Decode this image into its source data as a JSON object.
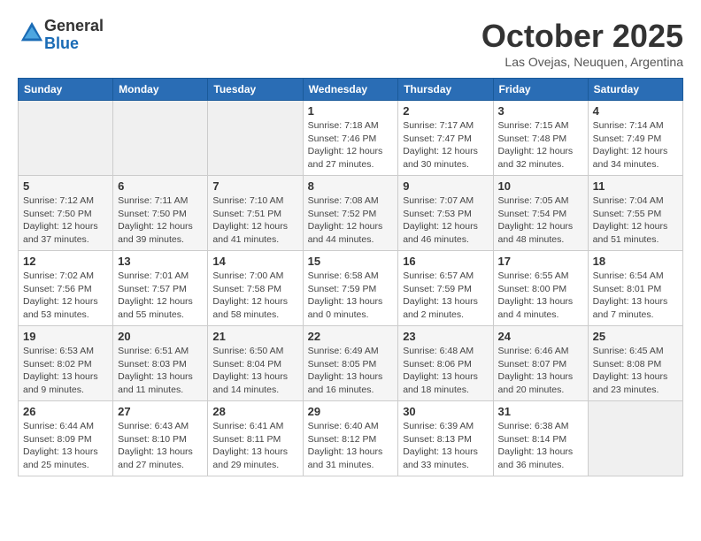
{
  "header": {
    "logo": {
      "line1": "General",
      "line2": "Blue"
    },
    "title": "October 2025",
    "location": "Las Ovejas, Neuquen, Argentina"
  },
  "weekdays": [
    "Sunday",
    "Monday",
    "Tuesday",
    "Wednesday",
    "Thursday",
    "Friday",
    "Saturday"
  ],
  "weeks": [
    [
      {
        "day": "",
        "info": ""
      },
      {
        "day": "",
        "info": ""
      },
      {
        "day": "",
        "info": ""
      },
      {
        "day": "1",
        "info": "Sunrise: 7:18 AM\nSunset: 7:46 PM\nDaylight: 12 hours\nand 27 minutes."
      },
      {
        "day": "2",
        "info": "Sunrise: 7:17 AM\nSunset: 7:47 PM\nDaylight: 12 hours\nand 30 minutes."
      },
      {
        "day": "3",
        "info": "Sunrise: 7:15 AM\nSunset: 7:48 PM\nDaylight: 12 hours\nand 32 minutes."
      },
      {
        "day": "4",
        "info": "Sunrise: 7:14 AM\nSunset: 7:49 PM\nDaylight: 12 hours\nand 34 minutes."
      }
    ],
    [
      {
        "day": "5",
        "info": "Sunrise: 7:12 AM\nSunset: 7:50 PM\nDaylight: 12 hours\nand 37 minutes."
      },
      {
        "day": "6",
        "info": "Sunrise: 7:11 AM\nSunset: 7:50 PM\nDaylight: 12 hours\nand 39 minutes."
      },
      {
        "day": "7",
        "info": "Sunrise: 7:10 AM\nSunset: 7:51 PM\nDaylight: 12 hours\nand 41 minutes."
      },
      {
        "day": "8",
        "info": "Sunrise: 7:08 AM\nSunset: 7:52 PM\nDaylight: 12 hours\nand 44 minutes."
      },
      {
        "day": "9",
        "info": "Sunrise: 7:07 AM\nSunset: 7:53 PM\nDaylight: 12 hours\nand 46 minutes."
      },
      {
        "day": "10",
        "info": "Sunrise: 7:05 AM\nSunset: 7:54 PM\nDaylight: 12 hours\nand 48 minutes."
      },
      {
        "day": "11",
        "info": "Sunrise: 7:04 AM\nSunset: 7:55 PM\nDaylight: 12 hours\nand 51 minutes."
      }
    ],
    [
      {
        "day": "12",
        "info": "Sunrise: 7:02 AM\nSunset: 7:56 PM\nDaylight: 12 hours\nand 53 minutes."
      },
      {
        "day": "13",
        "info": "Sunrise: 7:01 AM\nSunset: 7:57 PM\nDaylight: 12 hours\nand 55 minutes."
      },
      {
        "day": "14",
        "info": "Sunrise: 7:00 AM\nSunset: 7:58 PM\nDaylight: 12 hours\nand 58 minutes."
      },
      {
        "day": "15",
        "info": "Sunrise: 6:58 AM\nSunset: 7:59 PM\nDaylight: 13 hours\nand 0 minutes."
      },
      {
        "day": "16",
        "info": "Sunrise: 6:57 AM\nSunset: 7:59 PM\nDaylight: 13 hours\nand 2 minutes."
      },
      {
        "day": "17",
        "info": "Sunrise: 6:55 AM\nSunset: 8:00 PM\nDaylight: 13 hours\nand 4 minutes."
      },
      {
        "day": "18",
        "info": "Sunrise: 6:54 AM\nSunset: 8:01 PM\nDaylight: 13 hours\nand 7 minutes."
      }
    ],
    [
      {
        "day": "19",
        "info": "Sunrise: 6:53 AM\nSunset: 8:02 PM\nDaylight: 13 hours\nand 9 minutes."
      },
      {
        "day": "20",
        "info": "Sunrise: 6:51 AM\nSunset: 8:03 PM\nDaylight: 13 hours\nand 11 minutes."
      },
      {
        "day": "21",
        "info": "Sunrise: 6:50 AM\nSunset: 8:04 PM\nDaylight: 13 hours\nand 14 minutes."
      },
      {
        "day": "22",
        "info": "Sunrise: 6:49 AM\nSunset: 8:05 PM\nDaylight: 13 hours\nand 16 minutes."
      },
      {
        "day": "23",
        "info": "Sunrise: 6:48 AM\nSunset: 8:06 PM\nDaylight: 13 hours\nand 18 minutes."
      },
      {
        "day": "24",
        "info": "Sunrise: 6:46 AM\nSunset: 8:07 PM\nDaylight: 13 hours\nand 20 minutes."
      },
      {
        "day": "25",
        "info": "Sunrise: 6:45 AM\nSunset: 8:08 PM\nDaylight: 13 hours\nand 23 minutes."
      }
    ],
    [
      {
        "day": "26",
        "info": "Sunrise: 6:44 AM\nSunset: 8:09 PM\nDaylight: 13 hours\nand 25 minutes."
      },
      {
        "day": "27",
        "info": "Sunrise: 6:43 AM\nSunset: 8:10 PM\nDaylight: 13 hours\nand 27 minutes."
      },
      {
        "day": "28",
        "info": "Sunrise: 6:41 AM\nSunset: 8:11 PM\nDaylight: 13 hours\nand 29 minutes."
      },
      {
        "day": "29",
        "info": "Sunrise: 6:40 AM\nSunset: 8:12 PM\nDaylight: 13 hours\nand 31 minutes."
      },
      {
        "day": "30",
        "info": "Sunrise: 6:39 AM\nSunset: 8:13 PM\nDaylight: 13 hours\nand 33 minutes."
      },
      {
        "day": "31",
        "info": "Sunrise: 6:38 AM\nSunset: 8:14 PM\nDaylight: 13 hours\nand 36 minutes."
      },
      {
        "day": "",
        "info": ""
      }
    ]
  ]
}
